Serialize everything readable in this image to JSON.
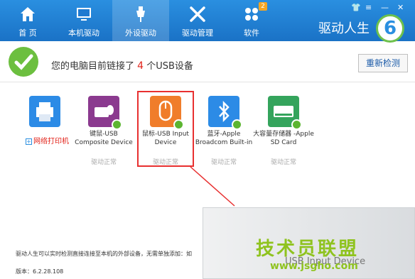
{
  "nav": {
    "items": [
      {
        "label": "首 页",
        "icon": "home-icon"
      },
      {
        "label": "本机驱动",
        "icon": "monitor-icon"
      },
      {
        "label": "外设驱动",
        "icon": "usb-icon"
      },
      {
        "label": "驱动管理",
        "icon": "wrench-icon"
      },
      {
        "label": "软件",
        "icon": "apps-icon",
        "badge": "2"
      }
    ],
    "brand": "驱动人生",
    "logo_digit": "6"
  },
  "status": {
    "prefix": "您的电脑目前链接了",
    "count": "4",
    "suffix": "个USB设备",
    "rescan_label": "重新检测"
  },
  "devices": [
    {
      "name": "",
      "status": "",
      "extra_label": "网络打印机"
    },
    {
      "name": "键鼠-USB Composite Device",
      "status": "驱动正常"
    },
    {
      "name": "鼠标-USB Input Device",
      "status": "驱动正常"
    },
    {
      "name": "蓝牙-Apple Broadcom Built-in",
      "status": "驱动正常"
    },
    {
      "name": "大容量存储器 -Apple SD Card",
      "status": "驱动正常"
    }
  ],
  "footer": {
    "note": "驱动人生可以实时检测直接连接至本机的外部设备，无需单独添加：如",
    "version": "版本：6.2.28.108"
  },
  "zoom": {
    "label": "USB Input Device"
  },
  "watermark": {
    "text": "技术员联盟",
    "url": "www.jsgho.com"
  },
  "colors": {
    "nav_bg": "#1a72c6",
    "accent_red": "#e2231a",
    "ok_green": "#5cb531",
    "brand_green": "#8fc31f"
  }
}
